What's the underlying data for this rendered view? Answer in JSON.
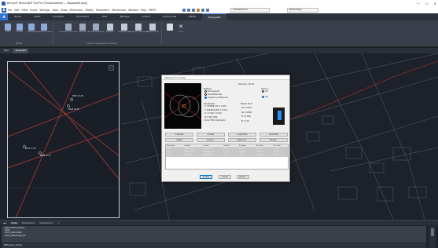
{
  "window": {
    "title": "Bricsys® BricsCAD® V24 Pro (Trial/Activated) — [Topografia.dwg]",
    "controls": [
      "—",
      "☐",
      "✕"
    ]
  },
  "menu": {
    "items": [
      "File",
      "Edit",
      "View",
      "Insert",
      "Settings",
      "Tools",
      "Draw",
      "Dimension",
      "Modify",
      "Parametric",
      "Mechanical",
      "Window",
      "Help",
      "MDT9"
    ],
    "workspace": "Arbeitsbereich",
    "layer": "Bodenbelag"
  },
  "tabs": [
    "Home",
    "Insert",
    "Annotate",
    "Parametric",
    "View",
    "Manage",
    "Output",
    "Pointclouds",
    "MDT9",
    "Topografía"
  ],
  "ribbon": {
    "buttons": [
      "Perfil",
      "Sección",
      "Compensar",
      "Grupo de secciones",
      "Generación de curvas",
      "Cubicación",
      "Sección transversal",
      "Replanteo",
      "Replantear eje",
      "Transformar coordenadas",
      "Transferir datos",
      "Cerrar"
    ],
    "groups": [
      "Perfiles",
      "Cálculo de superficies y volúmenes"
    ]
  },
  "doc_tabs": [
    "Start",
    "Topografía"
  ],
  "points": [
    {
      "id": "P003",
      "z": "14.28"
    },
    {
      "id": "P004",
      "z": "13.72"
    },
    {
      "id": "P007",
      "z": "11.35"
    },
    {
      "id": "P008",
      "z": "11.37"
    }
  ],
  "dialog": {
    "title": "Intersección Inversa",
    "result_label": "Solución 78 Dir",
    "method_title": "Método",
    "methods": [
      "Dos ángulos",
      "Dos Distancias",
      "Ángulos y Distancias"
    ],
    "options_title": "Opción",
    "options": [
      "2D",
      "3D"
    ],
    "results_title": "Resultados",
    "results_left": [
      "X: 376899.122 ± 0.057",
      "Y: 4064394.653 ± 0.013",
      "Z: 17.029 ± 0.032",
      "Ori: 361.2026",
      "Punto FIJO: Intermedio"
    ],
    "std_title": "Elipse Error",
    "results_right": [
      "Sa: 0.0163",
      "Sb: 0.0056",
      "θ: 27.38%",
      "Ec: 0.10"
    ],
    "buttons_row1": [
      "Cuadrado",
      "Circular",
      "Lineal Total",
      "Horizontal"
    ],
    "buttons_row2": [
      "Añadir",
      "Ángulo...",
      "Distancia...",
      "Mirada..."
    ],
    "table_headers": [
      "Elemento",
      "Coord X",
      "Coord Y",
      "Coord Z",
      "Err. Ang.",
      "Err. Dist.",
      "Err. Coor."
    ],
    "table_rows": [
      [
        "P003",
        "376891.85",
        "4064402.15",
        "14.28",
        "0.0011",
        "0.0021",
        "0.0045"
      ],
      [
        "P004",
        "376906.184",
        "4064399.721",
        "13.720",
        "-0.0011",
        "0.0020",
        "0.0038"
      ],
      [
        "P007",
        "376891.27",
        "4064385.18",
        "11.35",
        "0.0005",
        "0.0018",
        "0.0012"
      ]
    ],
    "bottom_buttons": [
      "Aceptar",
      "Anular",
      "Ayuda ..."
    ]
  },
  "layout_tabs": [
    "Model",
    "Presentación1",
    "Presentación2",
    "+"
  ],
  "command_history": [
    ": MDT9_TOPO_CALCULO",
    ": MDT9",
    ": MDT9_MODOVISOR",
    ": MDT9_MODOVISOR_OFF"
  ],
  "command_prompt": "MDT9_topo_calcular"
}
